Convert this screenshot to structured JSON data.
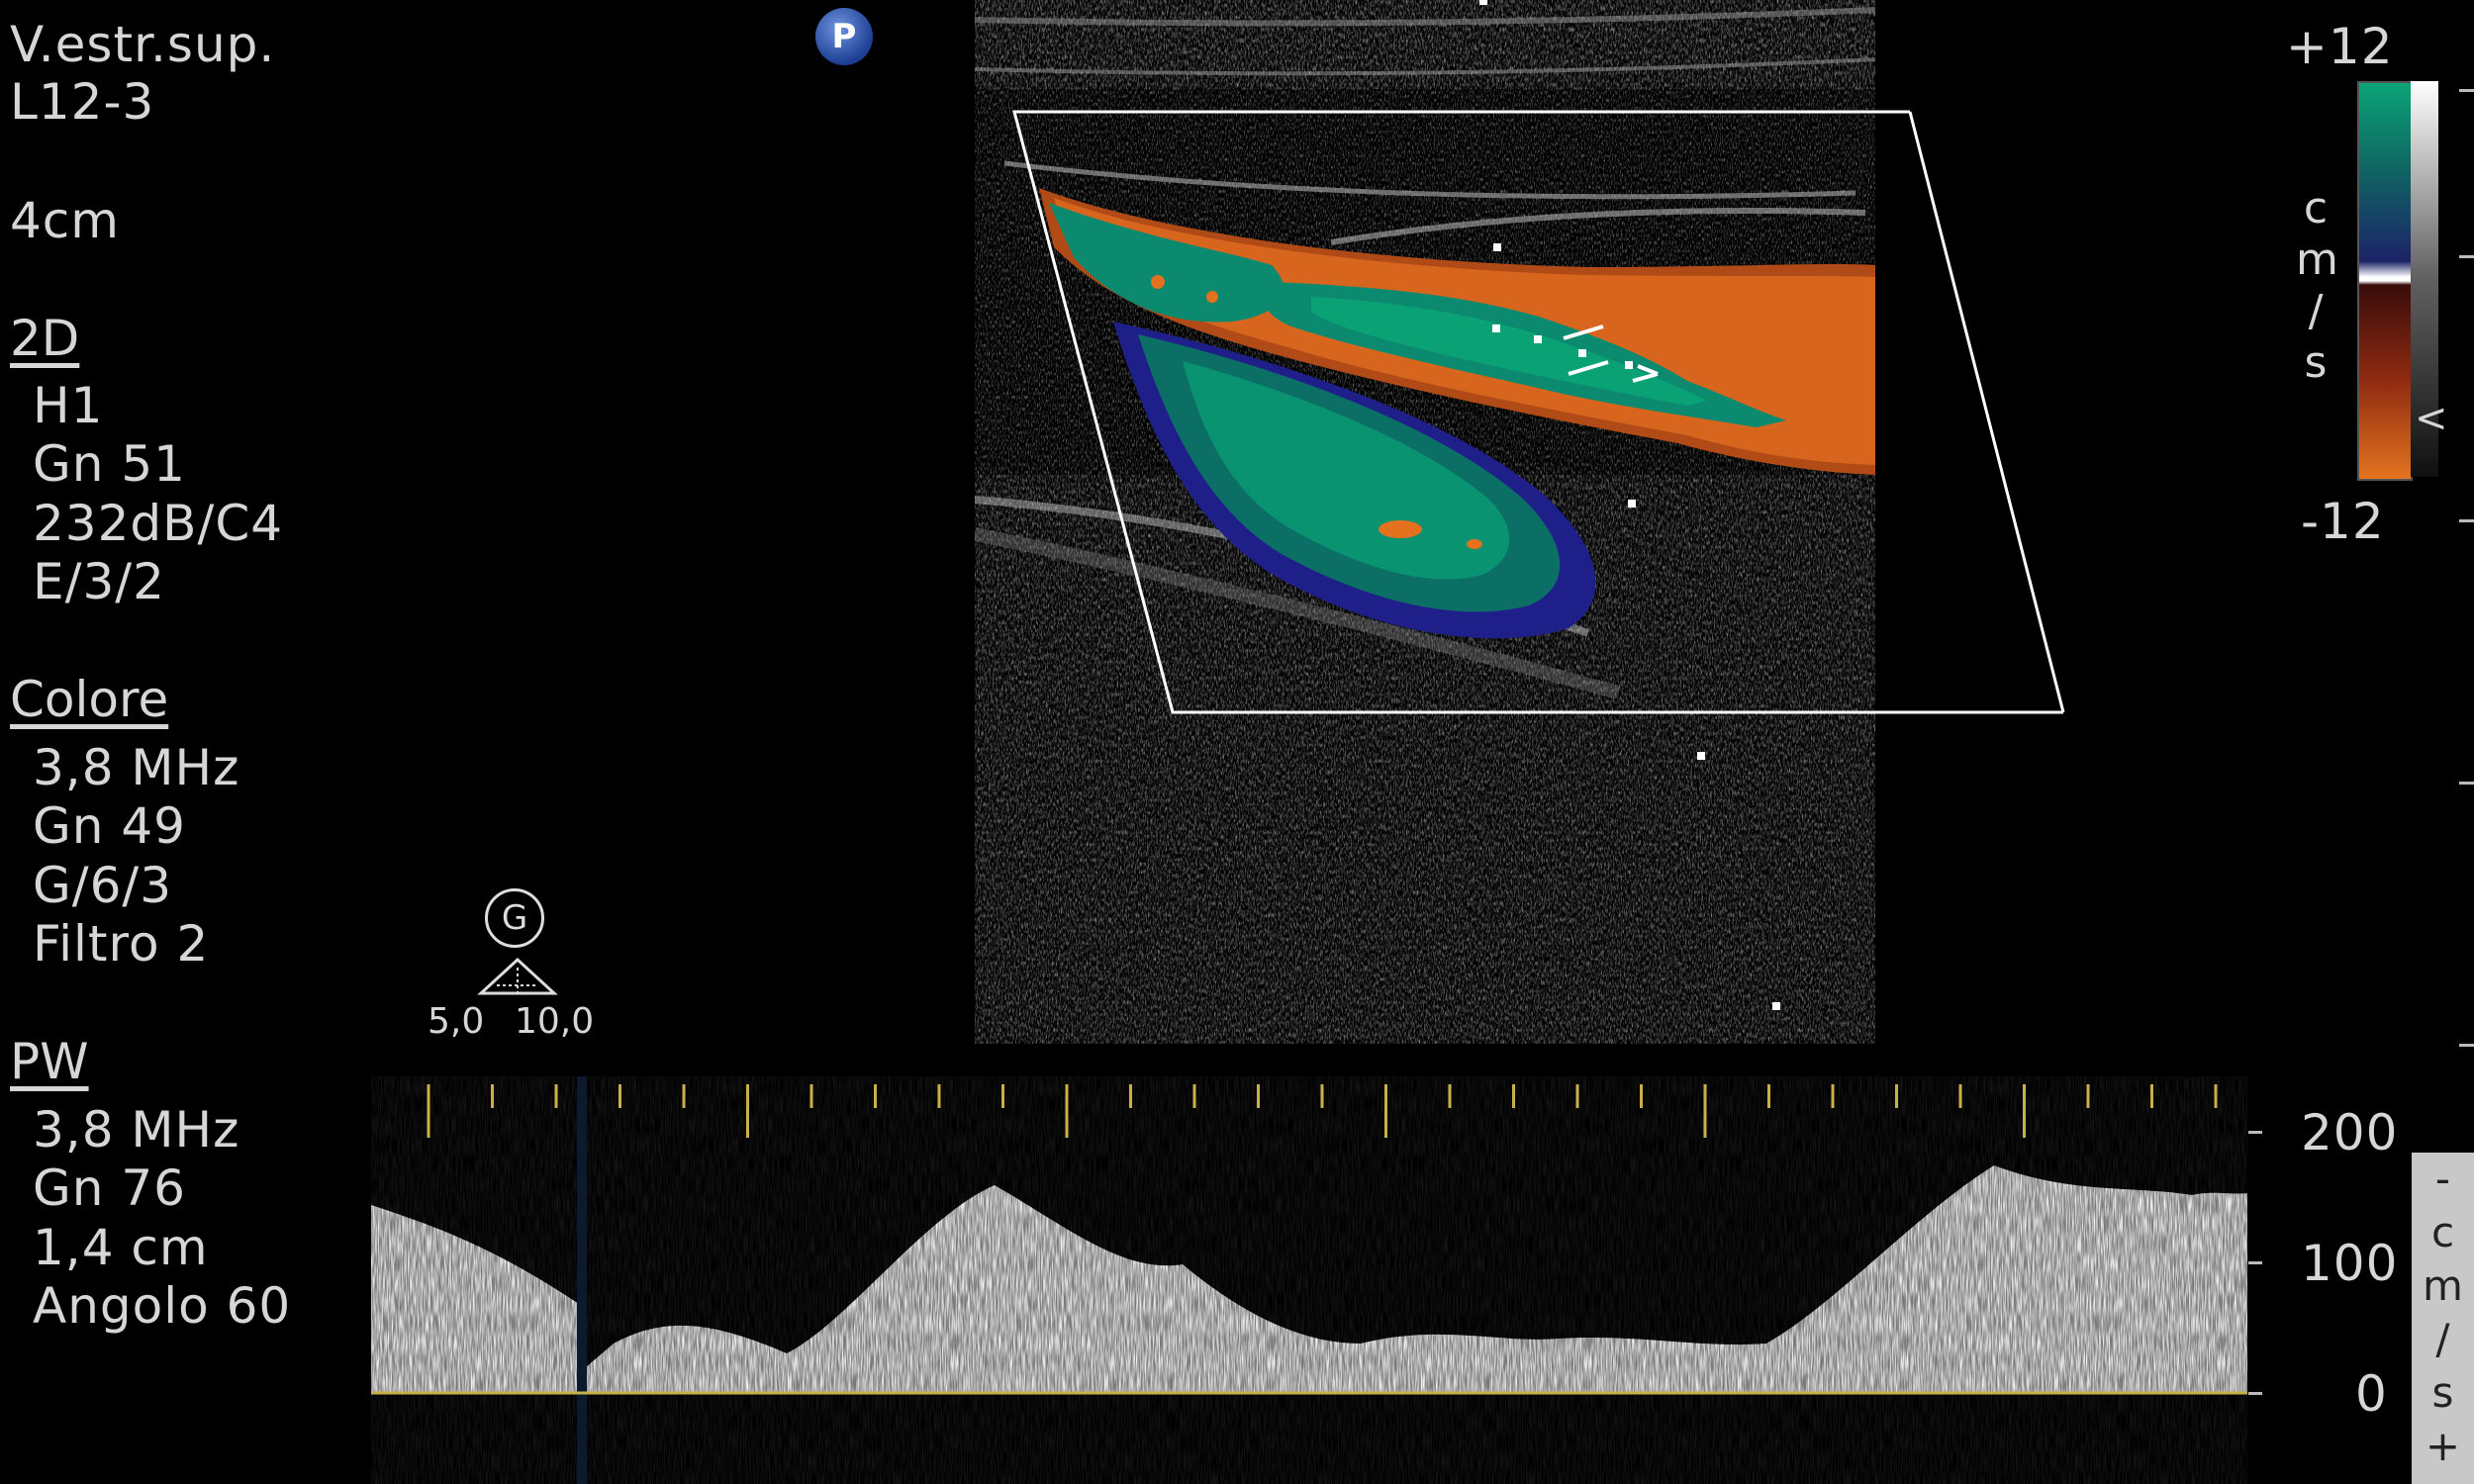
{
  "header": {
    "preset": "V.estr.sup.",
    "probe": "L12-3",
    "depth": "4cm"
  },
  "mode_2d": {
    "title": "2D",
    "items": [
      "H1",
      "Gn 51",
      "232dB/C4",
      "E/3/2"
    ]
  },
  "mode_color": {
    "title": "Colore",
    "items": [
      "3,8 MHz",
      "Gn 49",
      "G/6/3",
      "Filtro 2"
    ]
  },
  "mode_pw": {
    "title": "PW",
    "items": [
      "3,8 MHz",
      "Gn 76",
      "1,4 cm",
      "Angolo 60"
    ]
  },
  "badges": {
    "p": "P",
    "g": "G"
  },
  "focus": {
    "left": "5,0",
    "right": "10,0"
  },
  "color_scale": {
    "max": "+12",
    "min": "-12",
    "unit_chars": [
      "c",
      "m",
      "/",
      "s"
    ],
    "arrow": "<",
    "colors": {
      "top": "#0aa477",
      "mid": "#1c2367",
      "bottom": "#e37420"
    }
  },
  "doppler_scale": {
    "labels": [
      "200",
      "100",
      "0"
    ],
    "side_chars": [
      "-",
      "c",
      "m",
      "/",
      "s",
      "+"
    ]
  },
  "icons": {
    "probe_marker": "p-badge-icon",
    "gain_marker": "g-badge-icon",
    "focus_marker": "focus-triangle-icon"
  },
  "colors": {
    "baseline": "#c9b14a",
    "tick": "#c9b14a",
    "roi_box": "#ffffff"
  }
}
